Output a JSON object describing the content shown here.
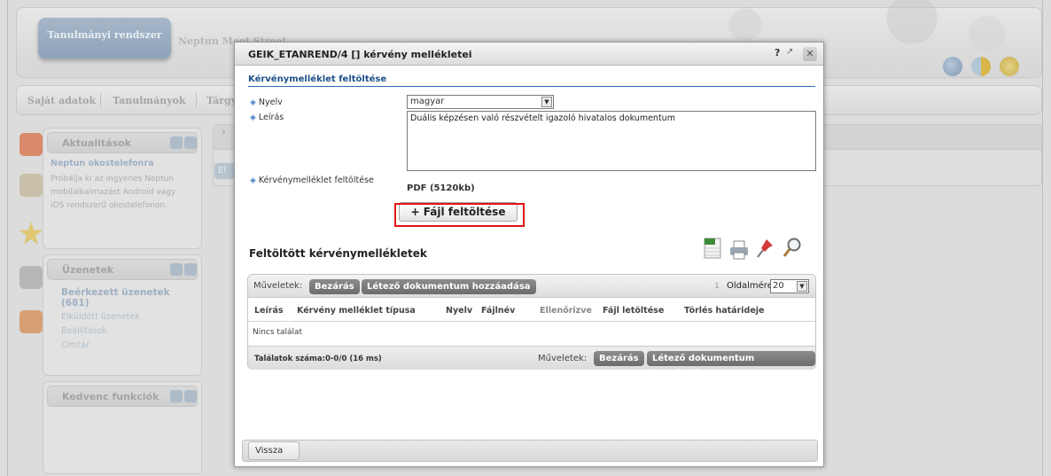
{
  "background": {
    "logo_tab": "Tanulmányi rendszer",
    "meet_tab": "Neptun Meet Street",
    "menu": [
      "Saját adatok",
      "Tanulmányok",
      "Tárgy"
    ],
    "panels": {
      "news": {
        "title": "Aktualitások",
        "item_title": "Neptun okostelefonra",
        "item_text_1": "Próbálja ki az ingyenes Neptun",
        "item_text_2": "mobilalkalmazást Android vagy",
        "item_text_3": "iOS rendszerű okostelefonon."
      },
      "messages": {
        "title": "Üzenetek",
        "items": [
          "Beérkezett üzenetek (681)",
          "Elküldött üzenetek",
          "Beállítások",
          "Címtár"
        ]
      },
      "favorites": {
        "title": "Kedvenc funkciók"
      }
    },
    "content_btn": "El"
  },
  "modal": {
    "title": "GEIK_ETANREND/4 [] kérvény mellékletei",
    "help": "?",
    "popout": "↗",
    "close": "✕",
    "section_title": "Kérvénymelléklet feltöltése",
    "form": {
      "language_label": "Nyelv",
      "language_value": "magyar",
      "description_label": "Leírás",
      "description_value": "Duális képzésen való részvételt igazoló hivatalos dokumentum",
      "upload_label": "Kérvénymelléklet feltöltése",
      "file_type": "PDF (5120kb)",
      "upload_button": "+ Fájl feltöltése"
    },
    "uploaded": {
      "title": "Feltöltött kérvénymellékletek",
      "actions_label": "Műveletek:",
      "close_btn": "Bezárás",
      "add_btn": "Létező dokumentum hozzáadása",
      "page_number": "1",
      "page_size_label": "Oldalméret",
      "page_size_value": "20",
      "columns": [
        "Leírás",
        "Kérvény melléklet típusa",
        "Nyelv",
        "Fájlnév",
        "Ellenőrizve",
        "Fájl letöltése",
        "Törlés határideje"
      ],
      "empty_text": "Nincs találat",
      "results_count": "Találatok száma:0-0/0 (16 ms)"
    },
    "back_button": "Vissza"
  }
}
